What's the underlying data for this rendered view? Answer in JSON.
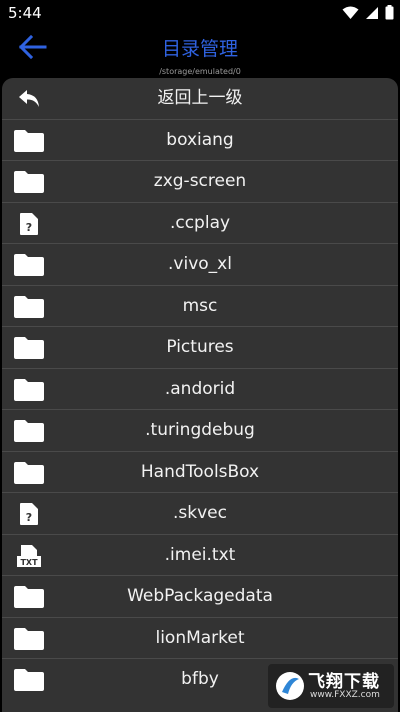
{
  "status": {
    "time": "5:44",
    "icons": [
      "wifi-icon",
      "signal-icon",
      "battery-icon"
    ]
  },
  "header": {
    "title": "目录管理",
    "path": "/storage/emulated/0",
    "back_icon": "back-arrow-icon",
    "title_color": "#2f62e0"
  },
  "list": {
    "items": [
      {
        "label": "返回上一级",
        "icon": "back-icon"
      },
      {
        "label": "boxiang",
        "icon": "folder-icon"
      },
      {
        "label": "zxg-screen",
        "icon": "folder-icon"
      },
      {
        "label": ".ccplay",
        "icon": "unknown-file-icon"
      },
      {
        "label": ".vivo_xl",
        "icon": "folder-icon"
      },
      {
        "label": "msc",
        "icon": "folder-icon"
      },
      {
        "label": "Pictures",
        "icon": "folder-icon"
      },
      {
        "label": ".andorid",
        "icon": "folder-icon"
      },
      {
        "label": ".turingdebug",
        "icon": "folder-icon"
      },
      {
        "label": "HandToolsBox",
        "icon": "folder-icon"
      },
      {
        "label": ".skvec",
        "icon": "unknown-file-icon"
      },
      {
        "label": ".imei.txt",
        "icon": "txt-file-icon"
      },
      {
        "label": "WebPackagedata",
        "icon": "folder-icon"
      },
      {
        "label": "lionMarket",
        "icon": "folder-icon"
      },
      {
        "label": "bfby",
        "icon": "folder-icon"
      }
    ]
  },
  "watermark": {
    "text": "飞翔下载",
    "url": "www.FXXZ.com"
  }
}
